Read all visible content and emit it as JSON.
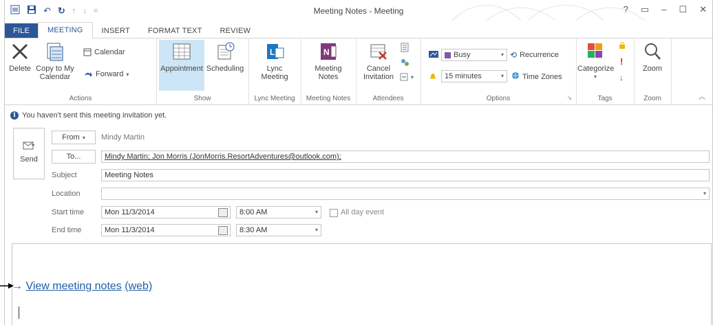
{
  "window": {
    "title": "Meeting Notes - Meeting",
    "controls": [
      "?",
      "▭",
      "–",
      "☐",
      "✕"
    ]
  },
  "quick_access": [
    "outlook-icon",
    "save-icon",
    "undo-icon",
    "redo-icon",
    "up-icon",
    "down-icon",
    "customize-icon"
  ],
  "tabs": [
    {
      "label": "FILE"
    },
    {
      "label": "MEETING"
    },
    {
      "label": "INSERT"
    },
    {
      "label": "FORMAT TEXT"
    },
    {
      "label": "REVIEW"
    }
  ],
  "ribbon": {
    "actions": {
      "group": "Actions",
      "delete": "Delete",
      "copy_to_my_calendar": "Copy to My Calendar",
      "calendar": "Calendar",
      "forward": "Forward"
    },
    "show": {
      "group": "Show",
      "appointment": "Appointment",
      "scheduling": "Scheduling"
    },
    "lync": {
      "group": "Lync Meeting",
      "lync_meeting": "Lync Meeting"
    },
    "meeting_notes": {
      "group": "Meeting Notes",
      "meeting_notes": "Meeting Notes"
    },
    "attendees": {
      "group": "Attendees",
      "cancel_invitation": "Cancel Invitation"
    },
    "options": {
      "group": "Options",
      "show_as": "Busy",
      "reminder": "15 minutes",
      "recurrence": "Recurrence",
      "time_zones": "Time Zones"
    },
    "tags": {
      "group": "Tags",
      "categorize": "Categorize"
    },
    "zoom": {
      "group": "Zoom",
      "zoom": "Zoom"
    }
  },
  "infobar": {
    "text": "You haven't sent this meeting invitation yet."
  },
  "form": {
    "send": "Send",
    "from_label": "From",
    "from_value": "Mindy Martin",
    "to_label": "To...",
    "to_value": "Mindy Martin; Jon Morris (JonMorris.ResortAdventures@outlook.com);",
    "subject_label": "Subject",
    "subject_value": "Meeting Notes",
    "location_label": "Location",
    "location_value": "",
    "start_label": "Start time",
    "start_date": "Mon 11/3/2014",
    "start_time": "8:00 AM",
    "all_day": "All day event",
    "end_label": "End time",
    "end_date": "Mon 11/3/2014",
    "end_time": "8:30 AM"
  },
  "body": {
    "link_arrow": "→",
    "link_text": "View meeting notes",
    "link_web": "(web)"
  }
}
